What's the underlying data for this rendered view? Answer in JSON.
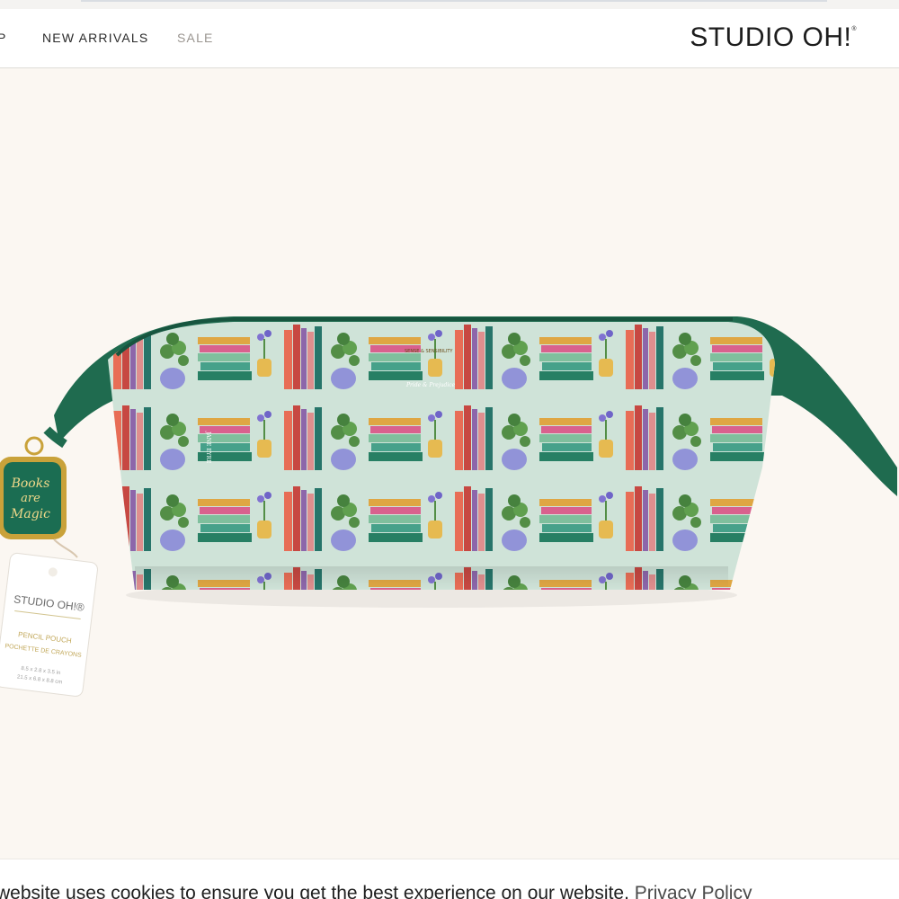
{
  "nav": {
    "partial_item": "P",
    "new_arrivals": "NEW ARRIVALS",
    "sale": "SALE"
  },
  "brand": {
    "logo_text": "STUDIO OH!",
    "logo_mark": "®"
  },
  "product": {
    "charm_text_1": "Books",
    "charm_text_2": "are",
    "charm_text_3": "Magic",
    "tag_brand": "STUDIO OH!®",
    "tag_line_1": "PENCIL POUCH",
    "tag_line_2": "POCHETTE DE CRAYONS",
    "tag_size_1": "8.5 x 2.8 x 3.5 in",
    "tag_size_2": "21.5 x 6.8 x 8.8 cm",
    "book_title_1": "JANE EYRE",
    "book_title_2": "Pride & Prejudice",
    "book_title_3": "SENSE & SENSIBILITY"
  },
  "cookie_banner": {
    "message": "website uses cookies to ensure you get the best experience on our website.",
    "link_label": "Privacy Policy"
  },
  "colors": {
    "page_background": "#fbf7f2",
    "pouch_body": "#cfe3d8",
    "pouch_trim": "#1f6b4f",
    "charm_green": "#1b6d52",
    "charm_gold": "#c9a23a"
  }
}
